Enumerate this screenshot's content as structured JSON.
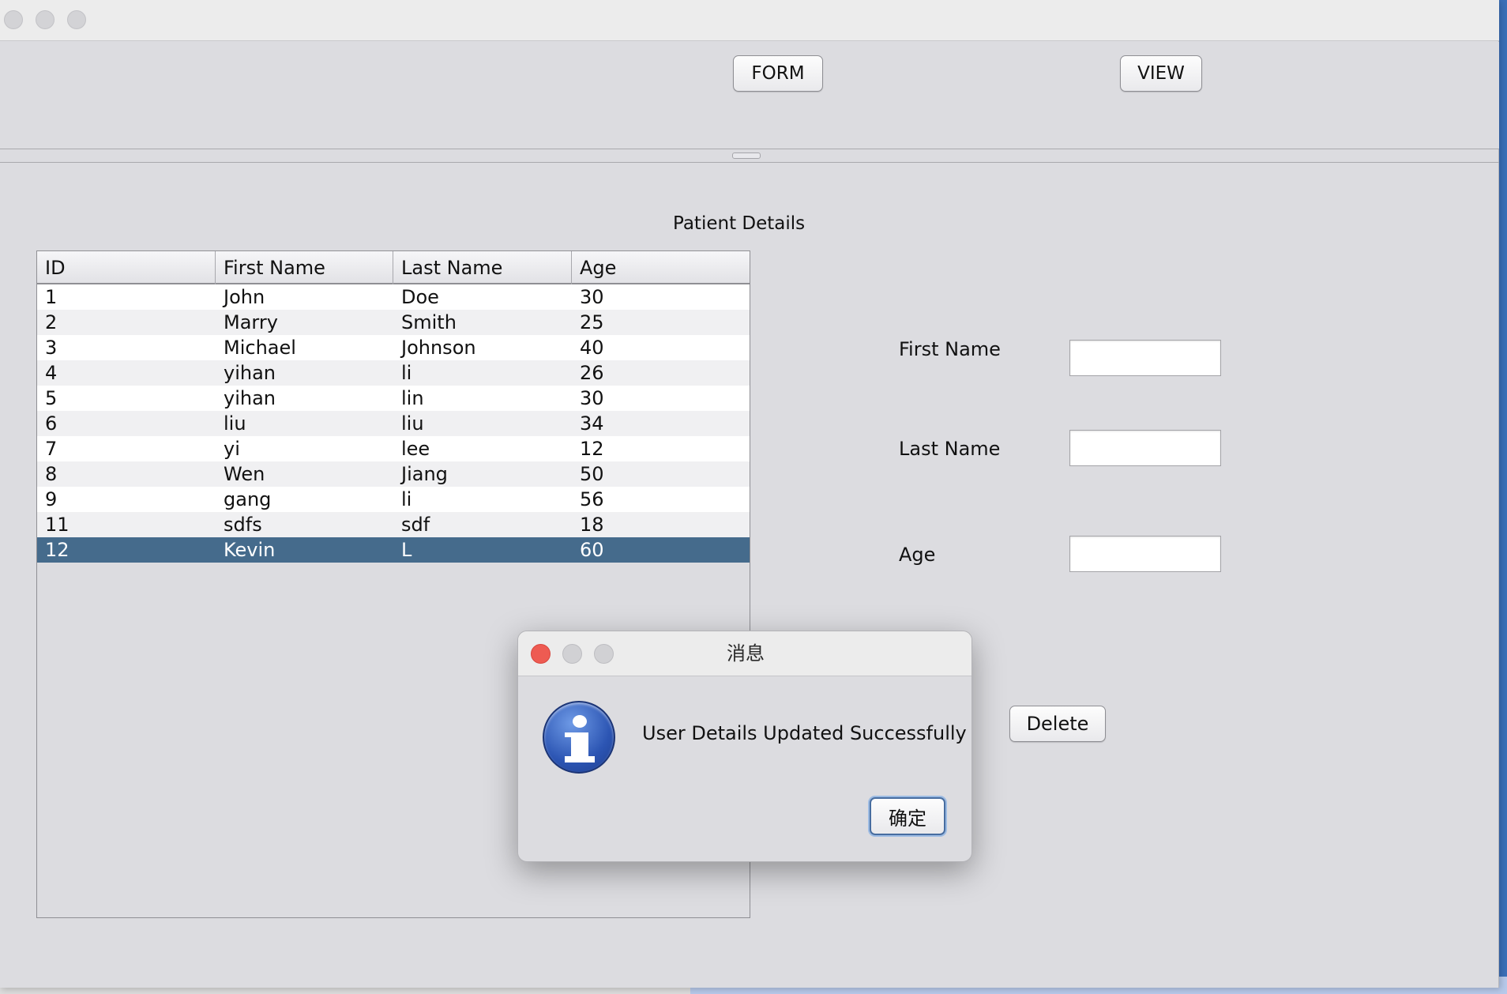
{
  "top_panel": {
    "form_button": "FORM",
    "view_button": "VIEW"
  },
  "panel_title": "Patient Details",
  "table": {
    "columns": [
      "ID",
      "First Name",
      "Last Name",
      "Age"
    ],
    "rows": [
      [
        "1",
        "John",
        "Doe",
        "30"
      ],
      [
        "2",
        "Marry",
        "Smith",
        "25"
      ],
      [
        "3",
        "Michael",
        "Johnson",
        "40"
      ],
      [
        "4",
        "yihan",
        "li",
        "26"
      ],
      [
        "5",
        "yihan",
        "lin",
        "30"
      ],
      [
        "6",
        "liu",
        "liu",
        "34"
      ],
      [
        "7",
        "yi",
        "lee",
        "12"
      ],
      [
        "8",
        "Wen",
        "Jiang",
        "50"
      ],
      [
        "9",
        "gang",
        "li",
        "56"
      ],
      [
        "11",
        "sdfs",
        "sdf",
        "18"
      ],
      [
        "12",
        "Kevin",
        "L",
        "60"
      ]
    ],
    "selected_row_index": 10
  },
  "form": {
    "first_name_label": "First Name",
    "first_name_value": "",
    "last_name_label": "Last Name",
    "last_name_value": "",
    "age_label": "Age",
    "age_value": "",
    "delete_button": "Delete"
  },
  "dialog": {
    "title": "消息",
    "message": "User Details Updated Successfully",
    "ok_button": "确定",
    "icon": "info-icon"
  },
  "colors": {
    "selection": "#456b8c",
    "window_bg": "#dcdce0",
    "close_red": "#ee5b52"
  }
}
